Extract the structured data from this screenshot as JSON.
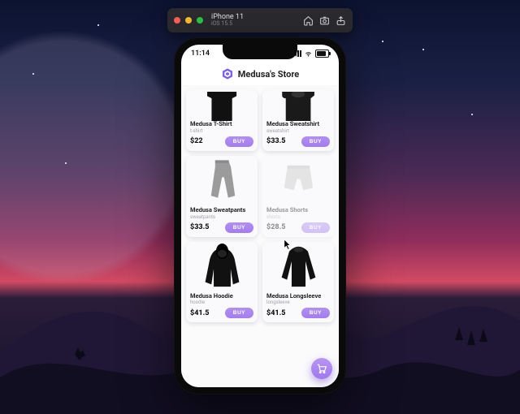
{
  "simulator": {
    "device": "iPhone 11",
    "os": "iOS 15.5"
  },
  "statusbar": {
    "time": "11:14"
  },
  "app": {
    "title": "Medusa's Store"
  },
  "products": [
    {
      "name": "Medusa T-Shirt",
      "category": "t-shirt",
      "price": "$22",
      "buy": "BUY"
    },
    {
      "name": "Medusa Sweatshirt",
      "category": "sweatshirt",
      "price": "$33.5",
      "buy": "BUY"
    },
    {
      "name": "Medusa Sweatpants",
      "category": "sweatpants",
      "price": "$33.5",
      "buy": "BUY"
    },
    {
      "name": "Medusa Shorts",
      "category": "shorts",
      "price": "$28.5",
      "buy": "BUY"
    },
    {
      "name": "Medusa Hoodie",
      "category": "hoodie",
      "price": "$41.5",
      "buy": "BUY"
    },
    {
      "name": "Medusa Longsleeve",
      "category": "longsleeve",
      "price": "$41.5",
      "buy": "BUY"
    }
  ],
  "colors": {
    "accent": "#9f78ef"
  }
}
